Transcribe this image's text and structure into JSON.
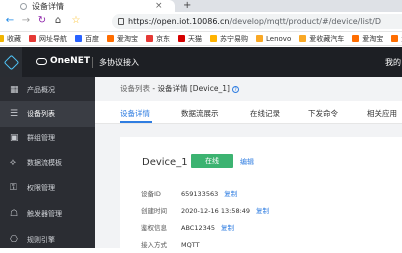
{
  "browser": {
    "tab_title": "设备详情",
    "new_tab_symbol": "+",
    "close_symbol": "×",
    "nav": {
      "back": "←",
      "forward": "→",
      "reload": "↻",
      "home": "⌂"
    },
    "url_host": "https://open.iot.10086.cn",
    "url_path": "/develop/mqtt/product/#/device/list/D"
  },
  "bookmarks": [
    {
      "label": "收藏",
      "color": "#f0b400"
    },
    {
      "label": "网址导航",
      "color": "#e53935"
    },
    {
      "label": "百度",
      "color": "#2962ff"
    },
    {
      "label": "爱淘宝",
      "color": "#ff6d00"
    },
    {
      "label": "京东",
      "color": "#e53935"
    },
    {
      "label": "天猫",
      "color": "#d50000"
    },
    {
      "label": "苏宁易购",
      "color": "#ffb300"
    },
    {
      "label": "Lenovo",
      "color": "#f9a825"
    },
    {
      "label": "爱收藏汽车",
      "color": "#f9a825"
    },
    {
      "label": "爱淘宝",
      "color": "#ff6d00"
    },
    {
      "label": "爱淘宝",
      "color": "#ff6d00"
    }
  ],
  "header": {
    "brand": "OneNET",
    "subtitle": "多协议接入",
    "right_text": "我的"
  },
  "sidebar": {
    "items": [
      {
        "label": "产品概况",
        "icon": "▦"
      },
      {
        "label": "设备列表",
        "icon": "☰"
      },
      {
        "label": "群组管理",
        "icon": "▣"
      },
      {
        "label": "数据流模板",
        "icon": "⟡"
      },
      {
        "label": "权限管理",
        "icon": "⚿"
      },
      {
        "label": "触发器管理",
        "icon": "☖"
      },
      {
        "label": "规则引擎",
        "icon": "⎔"
      }
    ]
  },
  "breadcrumb": {
    "parent": "设备列表",
    "separator": " - ",
    "current": "设备详情 [Device_1]",
    "help": "?"
  },
  "tabs": [
    "设备详情",
    "数据流展示",
    "在线记录",
    "下发命令",
    "相关应用"
  ],
  "device": {
    "name": "Device_1",
    "status": "在线",
    "edit_label": "编辑",
    "copy_label": "复制",
    "fields": [
      {
        "key": "设备ID",
        "value": "659133563",
        "copy": true
      },
      {
        "key": "创建时间",
        "value": "2020-12-16 13:58:49",
        "copy": true
      },
      {
        "key": "鉴权信息",
        "value": "ABC12345",
        "copy": true
      },
      {
        "key": "接入方式",
        "value": "MQTT",
        "copy": false
      }
    ]
  },
  "colors": {
    "accent": "#2f7de1",
    "online": "#3cb371",
    "sidebar": "#2b2d33",
    "header": "#1d1f24"
  }
}
